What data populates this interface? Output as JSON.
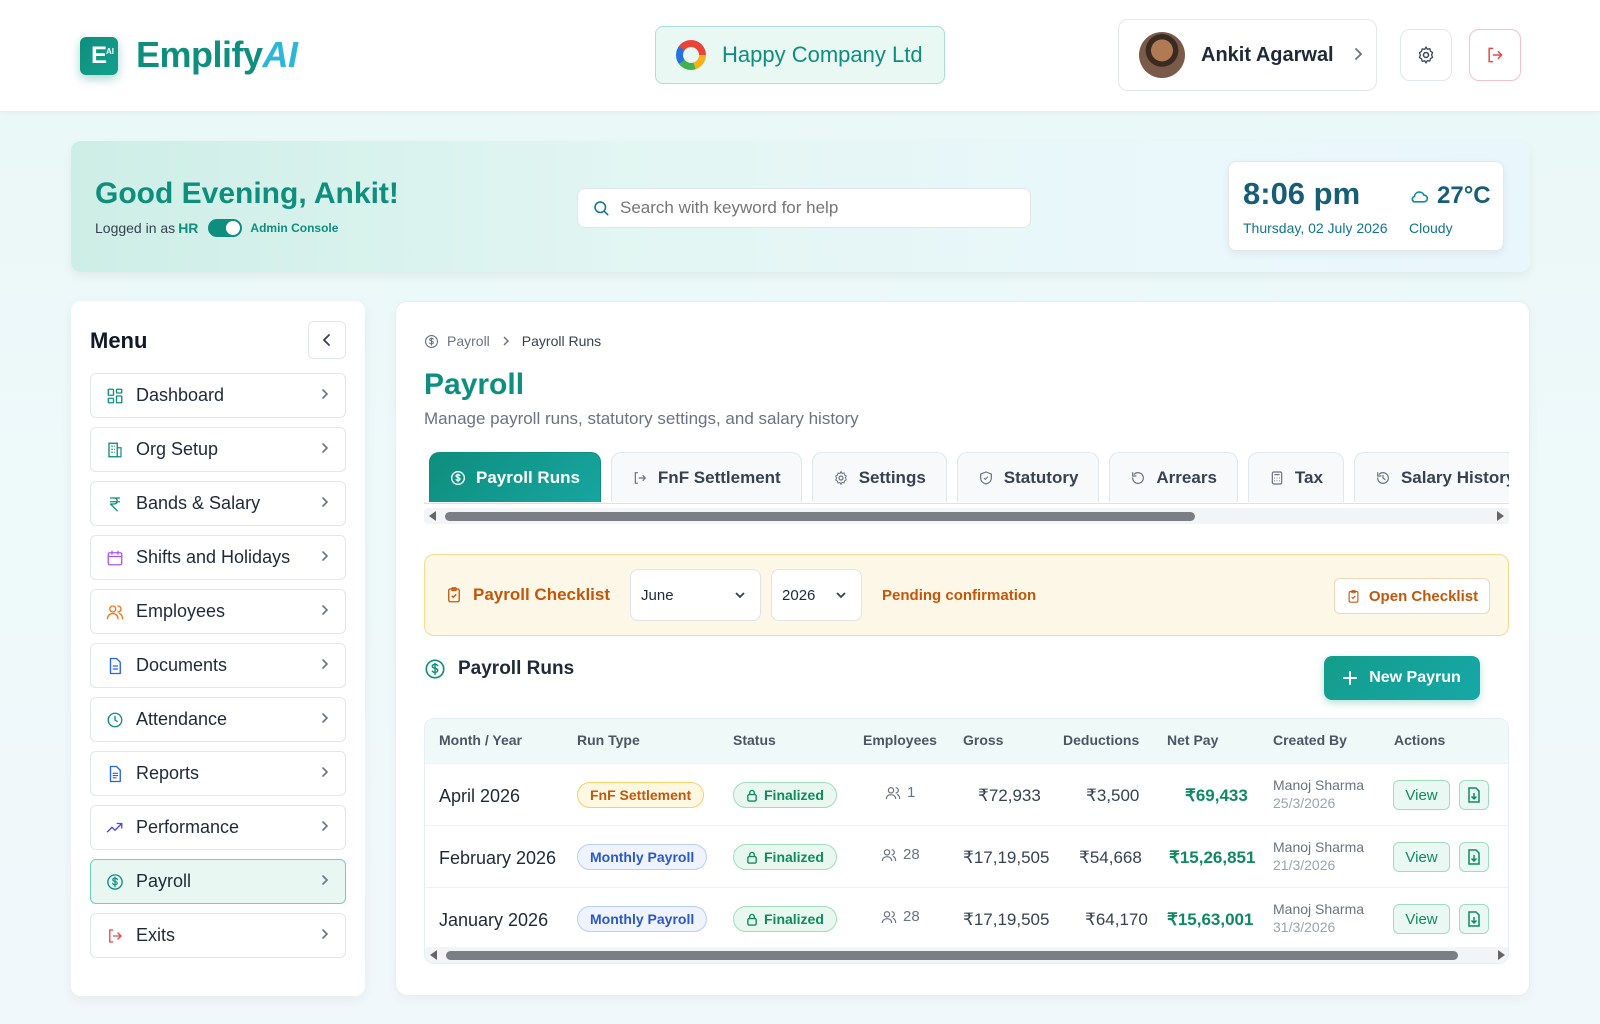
{
  "header": {
    "logo_letter": "E",
    "logo_sup": "AI",
    "brand_main": "Emplify",
    "brand_ai": "AI",
    "company": "Happy Company Ltd",
    "user_name": "Ankit Agarwal"
  },
  "greeting": {
    "title": "Good Evening, Ankit!",
    "logged_prefix": "Logged in as",
    "role": "HR",
    "console": "Admin Console",
    "search_placeholder": "Search with keyword for help",
    "time": "8:06 pm",
    "date": "Thursday, 02 July 2026",
    "temp": "27°C",
    "condition": "Cloudy"
  },
  "menu": {
    "title": "Menu",
    "items": [
      {
        "label": "Dashboard",
        "icon": "grid-icon"
      },
      {
        "label": "Org Setup",
        "icon": "building-icon"
      },
      {
        "label": "Bands & Salary",
        "icon": "rupee-icon"
      },
      {
        "label": "Shifts and Holidays",
        "icon": "calendar-icon"
      },
      {
        "label": "Employees",
        "icon": "users-icon"
      },
      {
        "label": "Documents",
        "icon": "document-icon"
      },
      {
        "label": "Attendance",
        "icon": "clock-icon"
      },
      {
        "label": "Reports",
        "icon": "report-icon"
      },
      {
        "label": "Performance",
        "icon": "trending-icon"
      },
      {
        "label": "Payroll",
        "icon": "dollar-circle-icon",
        "active": true
      },
      {
        "label": "Exits",
        "icon": "exit-icon"
      }
    ]
  },
  "main": {
    "breadcrumb": {
      "parent": "Payroll",
      "current": "Payroll Runs"
    },
    "title": "Payroll",
    "subtitle": "Manage payroll runs, statutory settings, and salary history",
    "tabs": [
      {
        "label": "Payroll Runs",
        "icon": "dollar-circle-icon",
        "active": true
      },
      {
        "label": "FnF Settlement",
        "icon": "exit-icon"
      },
      {
        "label": "Settings",
        "icon": "gear-icon"
      },
      {
        "label": "Statutory",
        "icon": "shield-icon"
      },
      {
        "label": "Arrears",
        "icon": "rotate-icon"
      },
      {
        "label": "Tax",
        "icon": "calculator-icon"
      },
      {
        "label": "Salary History",
        "icon": "history-icon"
      }
    ],
    "checklist": {
      "title": "Payroll Checklist",
      "month": "June",
      "year": "2026",
      "status": "Pending confirmation",
      "open_label": "Open Checklist"
    },
    "runs": {
      "title": "Payroll Runs",
      "new_label": "New Payrun",
      "columns": [
        "Month / Year",
        "Run Type",
        "Status",
        "Employees",
        "Gross",
        "Deductions",
        "Net Pay",
        "Created By",
        "Actions"
      ],
      "rows": [
        {
          "month": "April 2026",
          "type": "FnF Settlement",
          "type_style": "fnf",
          "status": "Finalized",
          "employees": "1",
          "gross": "₹72,933",
          "deductions": "₹3,500",
          "net": "₹69,433",
          "created_by": "Manoj Sharma",
          "created_on": "25/3/2026",
          "action": "View"
        },
        {
          "month": "February 2026",
          "type": "Monthly Payroll",
          "type_style": "monthly",
          "status": "Finalized",
          "employees": "28",
          "gross": "₹17,19,505",
          "deductions": "₹54,668",
          "net": "₹15,26,851",
          "created_by": "Manoj Sharma",
          "created_on": "21/3/2026",
          "action": "View"
        },
        {
          "month": "January 2026",
          "type": "Monthly Payroll",
          "type_style": "monthly",
          "status": "Finalized",
          "employees": "28",
          "gross": "₹17,19,505",
          "deductions": "₹64,170",
          "net": "₹15,63,001",
          "created_by": "Manoj Sharma",
          "created_on": "31/3/2026",
          "action": "View"
        }
      ]
    }
  }
}
